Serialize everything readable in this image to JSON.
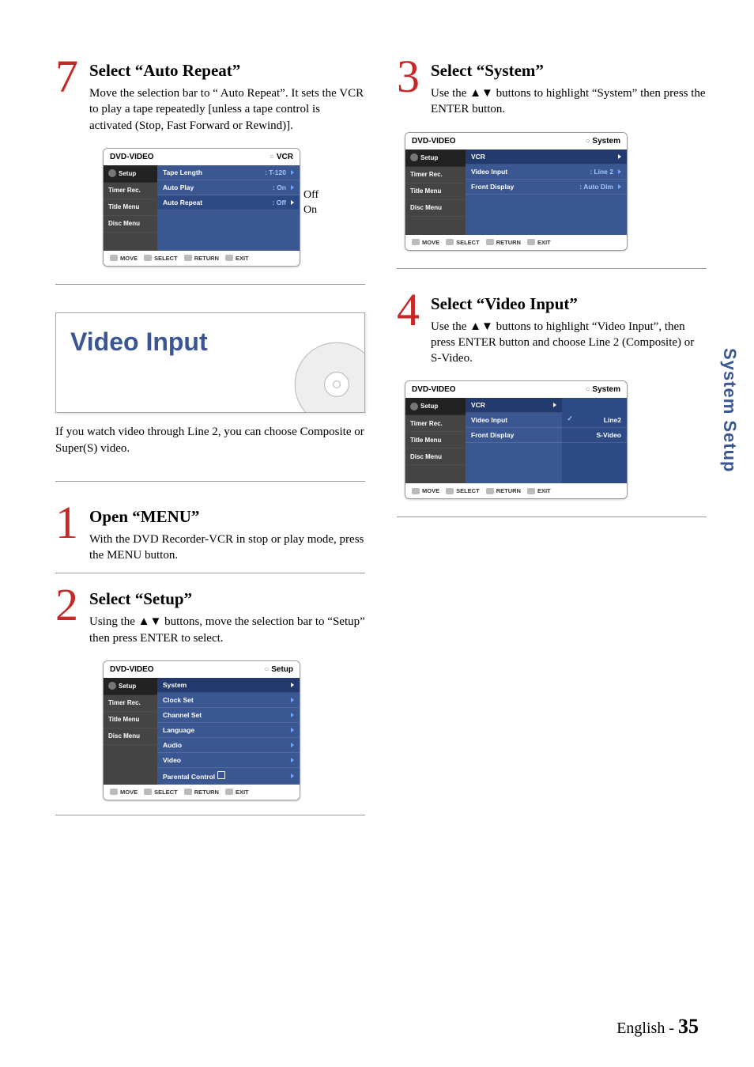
{
  "sidetab": "System Setup",
  "footer": {
    "lang": "English -",
    "page": "35"
  },
  "left": {
    "step7": {
      "num": "7",
      "title": "Select “Auto Repeat”",
      "desc": "Move the selection bar to “ Auto Repeat”. It sets the VCR to play a tape repeatedly [unless a tape control is activated (Stop, Fast Forward or Rewind)]."
    },
    "osd7": {
      "hl": "DVD-VIDEO",
      "hr": "VCR",
      "side": [
        "Setup",
        "Timer Rec.",
        "Title Menu",
        "Disc Menu"
      ],
      "rows": [
        {
          "l": "Tape Length",
          "v": ": T-120"
        },
        {
          "l": "Auto Play",
          "v": ": On"
        },
        {
          "l": "Auto Repeat",
          "v": ": Off"
        }
      ],
      "foot": [
        "MOVE",
        "SELECT",
        "RETURN",
        "EXIT"
      ],
      "callout": [
        "Off",
        "On"
      ]
    },
    "vi": {
      "title": "Video Input",
      "text": "If you watch video through Line 2, you can choose Composite or Super(S) video."
    },
    "step1": {
      "num": "1",
      "title": "Open “MENU”",
      "desc": "With the DVD Recorder-VCR in stop or play mode, press the MENU button."
    },
    "step2": {
      "num": "2",
      "title": "Select “Setup”",
      "desc": "Using the ▲▼ buttons, move the selection bar to “Setup” then press ENTER to select."
    },
    "osd2": {
      "hl": "DVD-VIDEO",
      "hr": "Setup",
      "side": [
        "Setup",
        "Timer Rec.",
        "Title Menu",
        "Disc Menu"
      ],
      "rows": [
        {
          "l": "System",
          "v": ""
        },
        {
          "l": "Clock Set",
          "v": ""
        },
        {
          "l": "Channel Set",
          "v": ""
        },
        {
          "l": "Language",
          "v": ""
        },
        {
          "l": "Audio",
          "v": ""
        },
        {
          "l": "Video",
          "v": ""
        },
        {
          "l": "Parental Control",
          "v": "",
          "lock": true
        }
      ],
      "foot": [
        "MOVE",
        "SELECT",
        "RETURN",
        "EXIT"
      ]
    }
  },
  "right": {
    "step3": {
      "num": "3",
      "title": "Select “System”",
      "desc": "Use the ▲▼ buttons to highlight “System” then press the ENTER button."
    },
    "osd3": {
      "hl": "DVD-VIDEO",
      "hr": "System",
      "side": [
        "Setup",
        "Timer Rec.",
        "Title Menu",
        "Disc Menu"
      ],
      "rows": [
        {
          "l": "VCR",
          "v": "",
          "header": true
        },
        {
          "l": "Video Input",
          "v": ": Line 2"
        },
        {
          "l": "Front Display",
          "v": ": Auto Dim"
        }
      ],
      "foot": [
        "MOVE",
        "SELECT",
        "RETURN",
        "EXIT"
      ]
    },
    "step4": {
      "num": "4",
      "title": "Select “Video Input”",
      "desc": "Use the ▲▼ buttons to highlight “Video Input”, then press ENTER button and choose Line 2 (Composite) or S-Video."
    },
    "osd4": {
      "hl": "DVD-VIDEO",
      "hr": "System",
      "side": [
        "Setup",
        "Timer Rec.",
        "Title Menu",
        "Disc Menu"
      ],
      "rows": [
        {
          "l": "VCR",
          "v": "",
          "header": true
        },
        {
          "l": "Video Input",
          "v": ""
        },
        {
          "l": "Front Display",
          "v": ""
        }
      ],
      "opts": [
        {
          "l": "Line2",
          "check": true
        },
        {
          "l": "S-Video"
        }
      ],
      "foot": [
        "MOVE",
        "SELECT",
        "RETURN",
        "EXIT"
      ]
    }
  }
}
